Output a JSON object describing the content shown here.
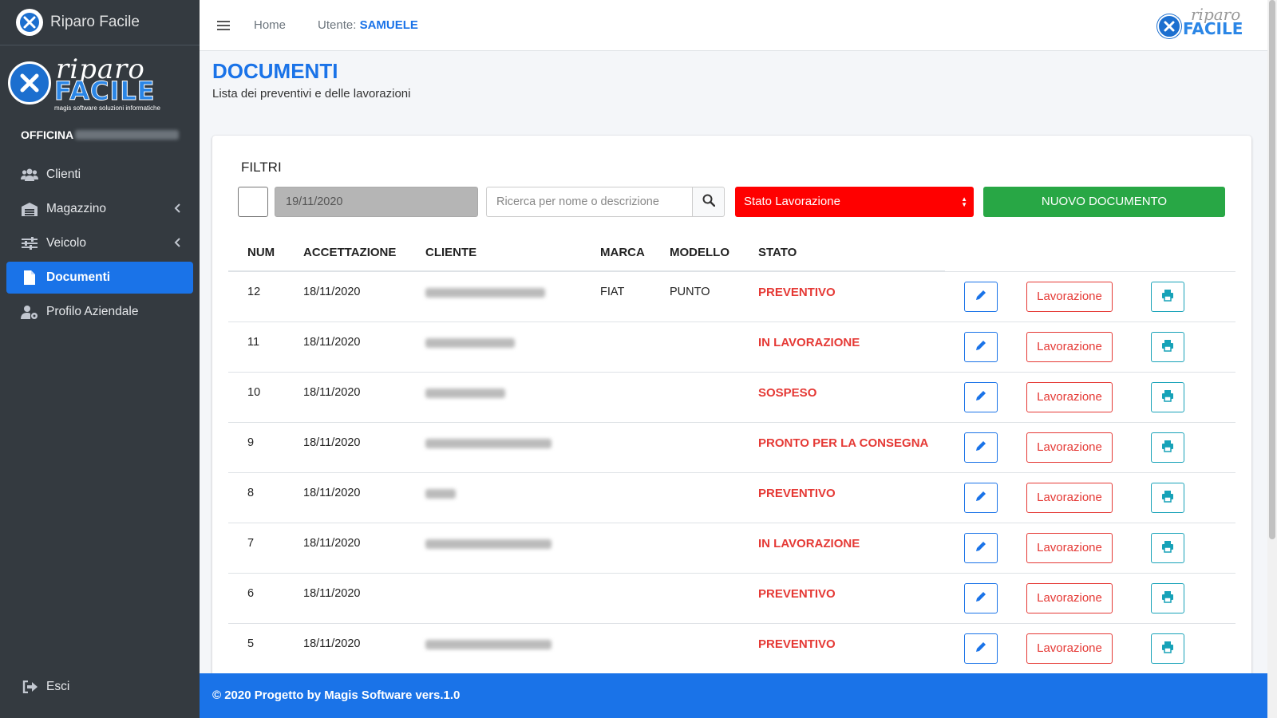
{
  "brand": {
    "name": "Riparo Facile"
  },
  "logo": {
    "script": "riparo",
    "word": "FACILE",
    "tagline": "magis software soluzioni informatiche"
  },
  "workshop": {
    "label": "OFFICINA"
  },
  "sidebar": {
    "items": [
      {
        "label": "Clienti",
        "icon": "users-icon"
      },
      {
        "label": "Magazzino",
        "icon": "warehouse-icon"
      },
      {
        "label": "Veicolo",
        "icon": "sliders-icon"
      },
      {
        "label": "Documenti",
        "icon": "file-icon",
        "active": true
      },
      {
        "label": "Profilo Aziendale",
        "icon": "user-cog-icon"
      }
    ],
    "logout": "Esci"
  },
  "header": {
    "home": "Home",
    "user_label": "Utente:",
    "user_name": "SAMUELE"
  },
  "page": {
    "title": "DOCUMENTI",
    "subtitle": "Lista dei preventivi e delle lavorazioni"
  },
  "filters": {
    "title": "FILTRI",
    "date_value": "19/11/2020",
    "search_placeholder": "Ricerca per nome o descrizione",
    "state_select": "Stato Lavorazione",
    "new_button": "NUOVO DOCUMENTO"
  },
  "table": {
    "headers": [
      "NUM",
      "ACCETTAZIONE",
      "CLIENTE",
      "MARCA",
      "MODELLO",
      "STATO"
    ],
    "action_label": "Lavorazione",
    "rows": [
      {
        "num": "12",
        "date": "18/11/2020",
        "marca": "FIAT",
        "modello": "PUNTO",
        "stato": "PREVENTIVO"
      },
      {
        "num": "11",
        "date": "18/11/2020",
        "marca": "",
        "modello": "",
        "stato": "IN LAVORAZIONE"
      },
      {
        "num": "10",
        "date": "18/11/2020",
        "marca": "",
        "modello": "",
        "stato": "SOSPESO"
      },
      {
        "num": "9",
        "date": "18/11/2020",
        "marca": "",
        "modello": "",
        "stato": "PRONTO PER LA CONSEGNA"
      },
      {
        "num": "8",
        "date": "18/11/2020",
        "marca": "",
        "modello": "",
        "stato": "PREVENTIVO"
      },
      {
        "num": "7",
        "date": "18/11/2020",
        "marca": "",
        "modello": "",
        "stato": "IN LAVORAZIONE"
      },
      {
        "num": "6",
        "date": "18/11/2020",
        "marca": "",
        "modello": "",
        "stato": "PREVENTIVO"
      },
      {
        "num": "5",
        "date": "18/11/2020",
        "marca": "",
        "modello": "",
        "stato": "PREVENTIVO"
      }
    ]
  },
  "footer": {
    "text": "© 2020 Progetto by Magis Software vers.1.0"
  },
  "colors": {
    "primary": "#1a73e8",
    "danger": "#e53935",
    "success": "#28a745",
    "sidebar": "#343a40",
    "select_bg": "#ff0000"
  }
}
